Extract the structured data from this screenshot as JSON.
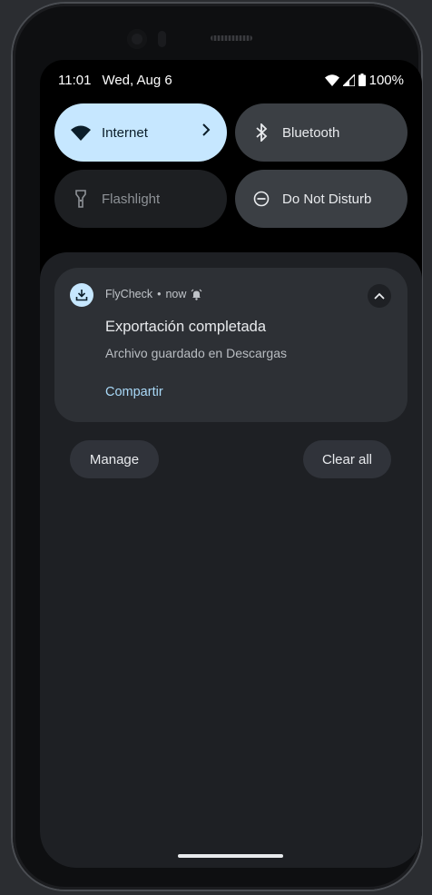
{
  "status_bar": {
    "time": "11:01",
    "date": "Wed, Aug 6",
    "battery": "100%"
  },
  "quick_tiles": [
    {
      "label": "Internet",
      "icon": "wifi-icon",
      "state": "on"
    },
    {
      "label": "Bluetooth",
      "icon": "bluetooth-icon",
      "state": "off"
    },
    {
      "label": "Flashlight",
      "icon": "flashlight-icon",
      "state": "unavailable"
    },
    {
      "label": "Do Not Disturb",
      "icon": "do-not-disturb-icon",
      "state": "off"
    }
  ],
  "notification": {
    "app_name": "FlyCheck",
    "separator": "•",
    "time": "now",
    "title": "Exportación completada",
    "body": "Archivo guardado en Descargas",
    "action": "Compartir"
  },
  "footer": {
    "manage": "Manage",
    "clear_all": "Clear all"
  },
  "colors": {
    "tile_active": "#c6e7ff",
    "tile_inactive": "#3b3f44",
    "shade": "#1e2024",
    "card": "#2d3035",
    "action_link": "#a9d9f8",
    "side_button": "#e0705c"
  }
}
